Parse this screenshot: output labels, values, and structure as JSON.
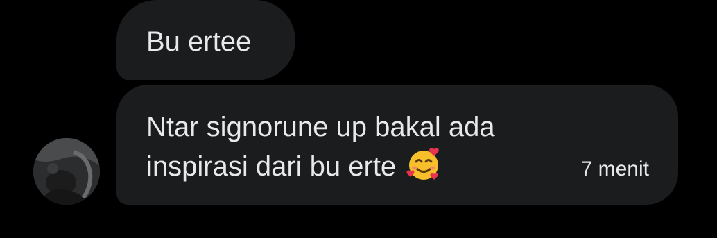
{
  "messages": [
    {
      "text": "Bu ertee"
    },
    {
      "text": "Ntar signorune up bakal ada inspirasi dari bu erte",
      "emoji": "smiling-face-with-hearts",
      "time": "7 menit"
    }
  ],
  "colors": {
    "background": "#000000",
    "bubble": "#1b1c1e",
    "text": "#e7e9ea",
    "emoji_face": "#f7c02a",
    "emoji_heart": "#e8344e"
  },
  "avatar": {
    "icon": "user-avatar-photo"
  }
}
